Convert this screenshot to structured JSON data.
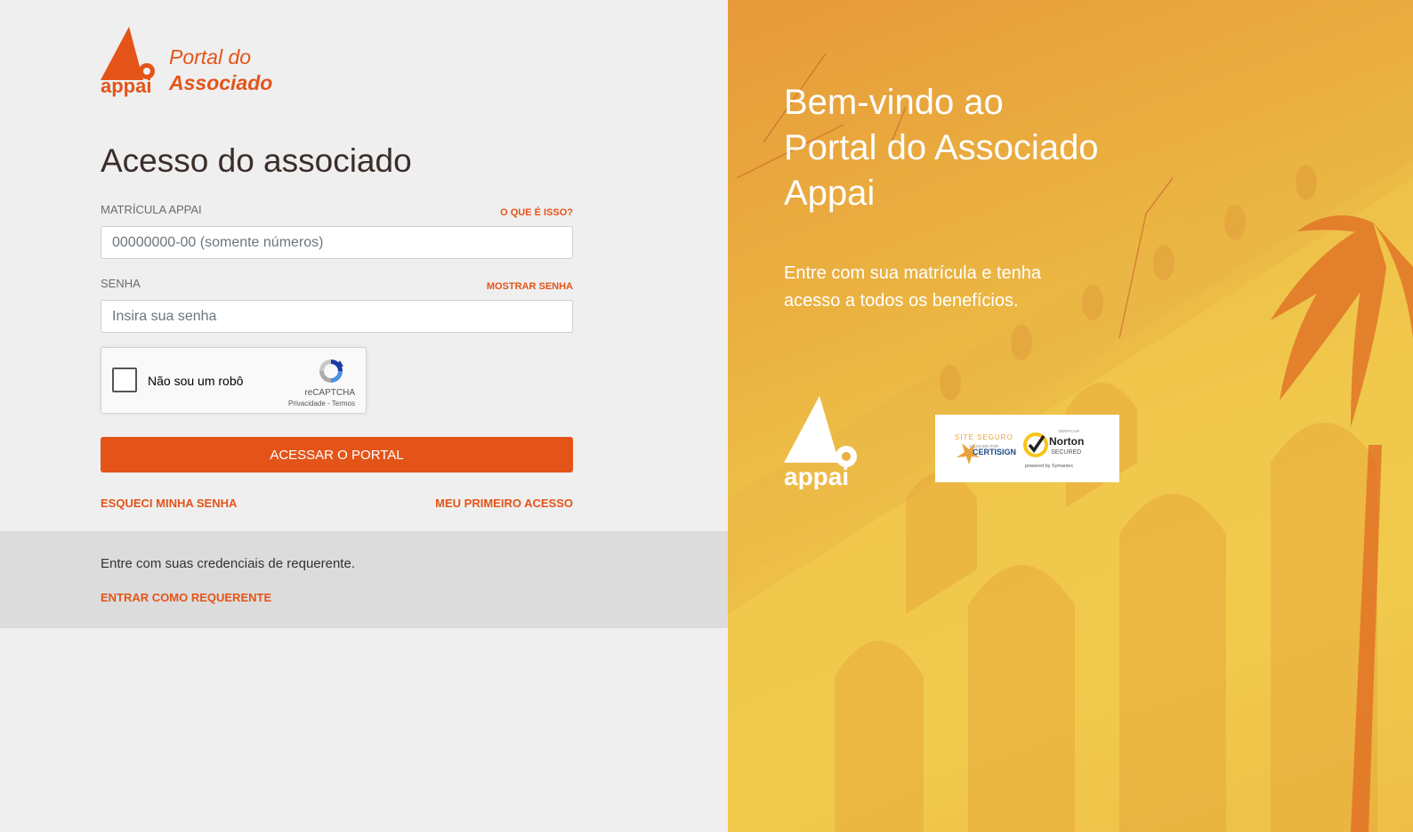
{
  "brand": {
    "logo_line1": "Portal do",
    "logo_line2": "Associado",
    "logo_word": "appai",
    "accent_color": "#e45419"
  },
  "login": {
    "title": "Acesso do associado",
    "matricula_label": "MATRÍCULA APPAI",
    "matricula_help": "O QUE É ISSO?",
    "matricula_value": "",
    "matricula_placeholder": "00000000-00 (somente números)",
    "senha_label": "SENHA",
    "senha_toggle": "MOSTRAR SENHA",
    "senha_value": "",
    "senha_placeholder": "Insira sua senha",
    "submit_label": "ACESSAR O PORTAL",
    "forgot_label": "ESQUECI MINHA SENHA",
    "first_access_label": "MEU PRIMEIRO ACESSO"
  },
  "recaptcha": {
    "label": "Não sou um robô",
    "brand": "reCAPTCHA",
    "terms": "Privacidade - Termos"
  },
  "requerente": {
    "text": "Entre com suas credenciais de requerente.",
    "link_label": "ENTRAR COMO REQUERENTE"
  },
  "hero": {
    "line1": "Bem-vindo ao",
    "line2": "Portal do Associado",
    "line3": "Appai",
    "subtitle": "Entre com sua matrícula e tenha acesso a todos os benefícios.",
    "seal_certisign_top": "SITE SEGURO",
    "seal_certisign_mid": "VALIDADO POR",
    "seal_certisign_name": "CERTISIGN",
    "seal_norton_top": "VERIFICAR",
    "seal_norton_name": "Norton",
    "seal_norton_sub": "SECURED",
    "seal_norton_by": "powered by Symantec"
  }
}
